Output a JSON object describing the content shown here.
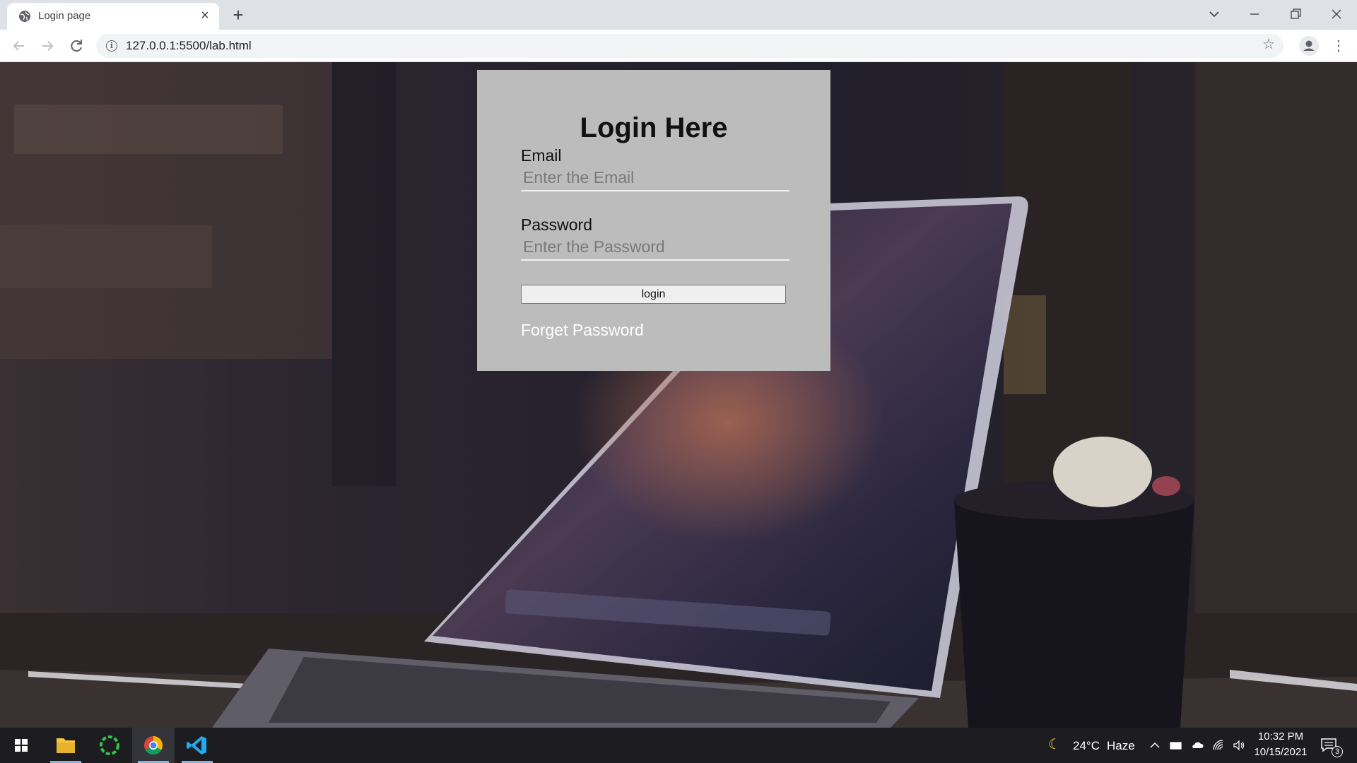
{
  "browser": {
    "tab": {
      "title": "Login page",
      "favicon": "globe-icon"
    },
    "url": "127.0.0.1:5500/lab.html",
    "icons": {
      "back": "back-arrow-icon",
      "forward": "forward-arrow-icon",
      "reload": "reload-icon",
      "info": "info-icon",
      "bookmark": "star-icon",
      "profile": "profile-icon",
      "menu": "kebab-menu-icon"
    }
  },
  "login": {
    "title": "Login Here",
    "email_label": "Email",
    "email_placeholder": "Enter the Email",
    "email_value": "",
    "password_label": "Password",
    "password_placeholder": "Enter the Password",
    "password_value": "",
    "button_label": "login",
    "forget_link": "Forget Password"
  },
  "taskbar": {
    "apps": [
      "windows-start-icon",
      "file-explorer-icon",
      "green-circle-app-icon",
      "chrome-icon",
      "vscode-icon"
    ],
    "weather": {
      "temp": "24°C",
      "condition": "Haze",
      "icon": "moon-icon"
    },
    "time": "10:32 PM",
    "date": "10/15/2021",
    "notification_count": "3"
  },
  "colors": {
    "card_bg": "#bcbcbc",
    "button_bg": "#efefef",
    "link": "#ffffff",
    "taskbar_bg": "#1c1c21"
  }
}
